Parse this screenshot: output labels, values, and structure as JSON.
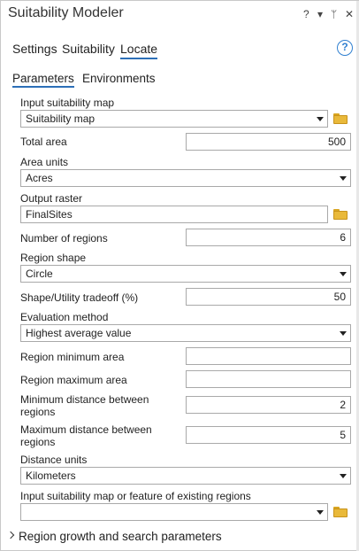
{
  "pane": {
    "title": "Suitability Modeler",
    "controls": {
      "help": "?",
      "menu": "▾",
      "pin": "ᛘ",
      "close": "✕"
    }
  },
  "tabs": [
    {
      "label": "Settings",
      "active": false
    },
    {
      "label": "Suitability",
      "active": false
    },
    {
      "label": "Locate",
      "active": true
    }
  ],
  "help_button": "?",
  "subtabs": [
    {
      "label": "Parameters",
      "active": true
    },
    {
      "label": "Environments",
      "active": false
    }
  ],
  "params": {
    "input_map": {
      "label": "Input suitability map",
      "value": "Suitability map"
    },
    "total_area": {
      "label": "Total area",
      "value": "500"
    },
    "area_units": {
      "label": "Area units",
      "value": "Acres"
    },
    "output_raster": {
      "label": "Output raster",
      "value": "FinalSites"
    },
    "num_regions": {
      "label": "Number of regions",
      "value": "6"
    },
    "region_shape": {
      "label": "Region shape",
      "value": "Circle"
    },
    "tradeoff": {
      "label": "Shape/Utility tradeoff (%)",
      "value": "50"
    },
    "eval_method": {
      "label": "Evaluation method",
      "value": "Highest average value"
    },
    "region_min_area": {
      "label": "Region minimum area",
      "value": ""
    },
    "region_max_area": {
      "label": "Region maximum area",
      "value": ""
    },
    "min_dist": {
      "label_line1": "Minimum distance between",
      "label_line2": "regions",
      "value": "2"
    },
    "max_dist": {
      "label_line1": "Maximum distance between",
      "label_line2": "regions",
      "value": "5"
    },
    "distance_units": {
      "label": "Distance units",
      "value": "Kilometers"
    },
    "existing_regions": {
      "label": "Input suitability map or feature of existing regions",
      "value": ""
    }
  },
  "expander": {
    "label": "Region growth and search parameters"
  },
  "colors": {
    "accent": "#2c6fb7",
    "folder": "#e9b93a"
  }
}
